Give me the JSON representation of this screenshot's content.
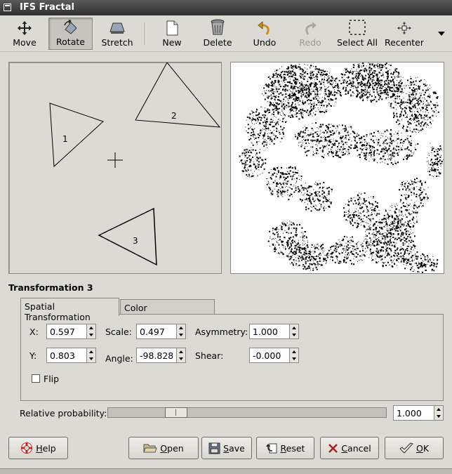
{
  "window": {
    "title": "IFS Fractal"
  },
  "toolbar": {
    "items": [
      {
        "label": "Move",
        "icon": "move-icon"
      },
      {
        "label": "Rotate",
        "icon": "rotate-icon",
        "active": true
      },
      {
        "label": "Stretch",
        "icon": "stretch-icon"
      },
      {
        "label": "New",
        "icon": "new-icon"
      },
      {
        "label": "Delete",
        "icon": "trash-icon"
      },
      {
        "label": "Undo",
        "icon": "undo-icon"
      },
      {
        "label": "Redo",
        "icon": "redo-icon",
        "disabled": true
      },
      {
        "label": "Select All",
        "icon": "select-all-icon"
      },
      {
        "label": "Recenter",
        "icon": "recenter-icon"
      }
    ]
  },
  "editor": {
    "triangles": [
      "1",
      "2",
      "3"
    ]
  },
  "transform": {
    "title": "Transformation 3",
    "tabs": [
      "Spatial Transformation",
      "Color Transformation"
    ],
    "fields": {
      "x": {
        "label": "X:",
        "value": "0.597"
      },
      "y": {
        "label": "Y:",
        "value": "0.803"
      },
      "scale": {
        "label": "Scale:",
        "value": "0.497"
      },
      "angle": {
        "label": "Angle:",
        "value": "-98.828"
      },
      "asymmetry": {
        "label": "Asymmetry:",
        "value": "1.000"
      },
      "shear": {
        "label": "Shear:",
        "value": "-0.000"
      }
    },
    "flip": {
      "label": "Flip",
      "checked": false
    }
  },
  "probability": {
    "label": "Relative probability:",
    "value": "1.000",
    "slider_fraction": 0.2
  },
  "buttons": {
    "help": {
      "mnemonic": "H",
      "rest": "elp"
    },
    "open": {
      "mnemonic": "O",
      "rest": "pen"
    },
    "save": {
      "mnemonic": "S",
      "rest": "ave"
    },
    "reset": {
      "mnemonic": "R",
      "rest": "eset"
    },
    "cancel": {
      "mnemonic": "C",
      "rest": "ancel"
    },
    "ok": {
      "mnemonic": "O",
      "rest": "K"
    }
  }
}
